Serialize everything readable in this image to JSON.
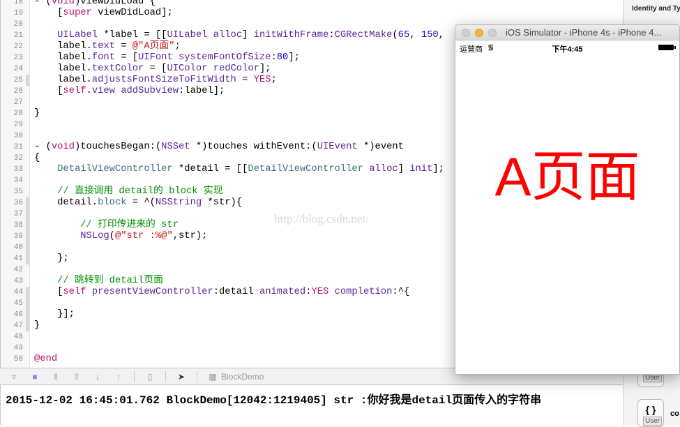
{
  "editor": {
    "lines": [
      {
        "n": "18",
        "tokens": [
          [
            "- (",
            ""
          ],
          [
            "void",
            "t-kw"
          ],
          [
            ")viewDidLoad {",
            ""
          ]
        ]
      },
      {
        "n": "19",
        "tokens": [
          [
            "    [",
            ""
          ],
          [
            "super",
            "t-kw"
          ],
          [
            " viewDidLoad];",
            ""
          ]
        ]
      },
      {
        "n": "20",
        "tokens": []
      },
      {
        "n": "21",
        "tokens": [
          [
            "    ",
            ""
          ],
          [
            "UILabel",
            "t-type"
          ],
          [
            " *label = [[",
            ""
          ],
          [
            "UILabel",
            "t-type"
          ],
          [
            " ",
            ""
          ],
          [
            "alloc",
            "t-type"
          ],
          [
            "] ",
            ""
          ],
          [
            "initWithFrame",
            "t-type"
          ],
          [
            ":",
            ""
          ],
          [
            "CGRectMake",
            "t-type"
          ],
          [
            "(",
            ""
          ],
          [
            "65",
            "t-num"
          ],
          [
            ", ",
            ""
          ],
          [
            "150",
            "t-num"
          ],
          [
            ",",
            ""
          ]
        ]
      },
      {
        "n": "22",
        "tokens": [
          [
            "    label.",
            ""
          ],
          [
            "text",
            "t-prop"
          ],
          [
            " = ",
            ""
          ],
          [
            "@\"A页面\"",
            "t-str"
          ],
          [
            ";",
            ""
          ]
        ]
      },
      {
        "n": "23",
        "tokens": [
          [
            "    label.",
            ""
          ],
          [
            "font",
            "t-prop"
          ],
          [
            " = [",
            ""
          ],
          [
            "UIFont",
            "t-type"
          ],
          [
            " ",
            ""
          ],
          [
            "systemFontOfSize",
            "t-type"
          ],
          [
            ":",
            ""
          ],
          [
            "80",
            "t-num"
          ],
          [
            "];",
            ""
          ]
        ]
      },
      {
        "n": "24",
        "tokens": [
          [
            "    label.",
            ""
          ],
          [
            "textColor",
            "t-prop"
          ],
          [
            " = [",
            ""
          ],
          [
            "UIColor",
            "t-type"
          ],
          [
            " ",
            ""
          ],
          [
            "redColor",
            "t-type"
          ],
          [
            "];",
            ""
          ]
        ]
      },
      {
        "n": "25",
        "tokens": [
          [
            "    label.",
            ""
          ],
          [
            "adjustsFontSizeToFitWidth",
            "t-prop"
          ],
          [
            " = ",
            ""
          ],
          [
            "YES",
            "t-kw"
          ],
          [
            ";",
            ""
          ]
        ]
      },
      {
        "n": "26",
        "tokens": [
          [
            "    [",
            ""
          ],
          [
            "self",
            "t-kw"
          ],
          [
            ".",
            ""
          ],
          [
            "view",
            "t-prop"
          ],
          [
            " ",
            ""
          ],
          [
            "addSubview",
            "t-type"
          ],
          [
            ":label];",
            ""
          ]
        ]
      },
      {
        "n": "27",
        "tokens": []
      },
      {
        "n": "28",
        "tokens": [
          [
            "}",
            ""
          ]
        ]
      },
      {
        "n": "29",
        "tokens": []
      },
      {
        "n": "30",
        "tokens": []
      },
      {
        "n": "31",
        "tokens": [
          [
            "- (",
            ""
          ],
          [
            "void",
            "t-kw"
          ],
          [
            ")touchesBegan:(",
            ""
          ],
          [
            "NSSet",
            "t-type"
          ],
          [
            " *)touches withEvent:(",
            ""
          ],
          [
            "UIEvent",
            "t-type"
          ],
          [
            " *)event",
            ""
          ]
        ]
      },
      {
        "n": "32",
        "tokens": [
          [
            "{",
            ""
          ]
        ]
      },
      {
        "n": "33",
        "tokens": [
          [
            "    ",
            ""
          ],
          [
            "DetailViewController",
            "t-cls"
          ],
          [
            " *detail = [[",
            ""
          ],
          [
            "DetailViewController",
            "t-cls"
          ],
          [
            " ",
            ""
          ],
          [
            "alloc",
            "t-type"
          ],
          [
            "] ",
            ""
          ],
          [
            "init",
            "t-type"
          ],
          [
            "];",
            ""
          ]
        ]
      },
      {
        "n": "34",
        "tokens": []
      },
      {
        "n": "35",
        "tokens": [
          [
            "    // 直接调用 detail的 block 实现",
            "t-cmt"
          ]
        ]
      },
      {
        "n": "36",
        "tokens": [
          [
            "    detail.",
            ""
          ],
          [
            "block",
            "t-cls"
          ],
          [
            " = ^(",
            ""
          ],
          [
            "NSString",
            "t-type"
          ],
          [
            " *str){",
            ""
          ]
        ]
      },
      {
        "n": "37",
        "tokens": []
      },
      {
        "n": "38",
        "tokens": [
          [
            "        // 打印传进来的 str",
            "t-cmt"
          ]
        ]
      },
      {
        "n": "39",
        "tokens": [
          [
            "        ",
            ""
          ],
          [
            "NSLog",
            "t-type"
          ],
          [
            "(",
            ""
          ],
          [
            "@\"str :%@\"",
            "t-str"
          ],
          [
            ",str);",
            ""
          ]
        ]
      },
      {
        "n": "40",
        "tokens": []
      },
      {
        "n": "41",
        "tokens": [
          [
            "    };",
            ""
          ]
        ]
      },
      {
        "n": "42",
        "tokens": []
      },
      {
        "n": "43",
        "tokens": [
          [
            "    // 跳转到 detail页面",
            "t-cmt"
          ]
        ]
      },
      {
        "n": "44",
        "tokens": [
          [
            "    [",
            ""
          ],
          [
            "self",
            "t-kw"
          ],
          [
            " ",
            ""
          ],
          [
            "presentViewController",
            "t-type"
          ],
          [
            ":detail ",
            ""
          ],
          [
            "animated",
            "t-type"
          ],
          [
            ":",
            ""
          ],
          [
            "YES",
            "t-kw"
          ],
          [
            " ",
            ""
          ],
          [
            "completion",
            "t-type"
          ],
          [
            ":^{",
            ""
          ]
        ]
      },
      {
        "n": "45",
        "tokens": []
      },
      {
        "n": "46",
        "tokens": [
          [
            "    }];",
            ""
          ]
        ]
      },
      {
        "n": "47",
        "tokens": [
          [
            "}",
            ""
          ]
        ]
      },
      {
        "n": "48",
        "tokens": []
      },
      {
        "n": "49",
        "tokens": []
      },
      {
        "n": "50",
        "tokens": [
          [
            "@end",
            "t-kw"
          ]
        ]
      }
    ],
    "watermark": "http://blog.csdn.net/"
  },
  "debugbar": {
    "target": "BlockDemo"
  },
  "console": {
    "output": "2015-12-02 16:45:01.762 BlockDemo[12042:1219405] str :你好我是detail页面传入的字符串"
  },
  "inspector": {
    "title": "Identity and Type",
    "library": [
      {
        "glyph": "{ }",
        "tag": "User",
        "label": "co"
      },
      {
        "glyph": "{ }",
        "tag": "User",
        "label": "co"
      }
    ]
  },
  "simulator": {
    "title": "iOS Simulator - iPhone 4s - iPhone 4...",
    "carrier": "运营商",
    "time": "下午4:45",
    "label_text": "A页面",
    "label_color": "#ff0000"
  }
}
